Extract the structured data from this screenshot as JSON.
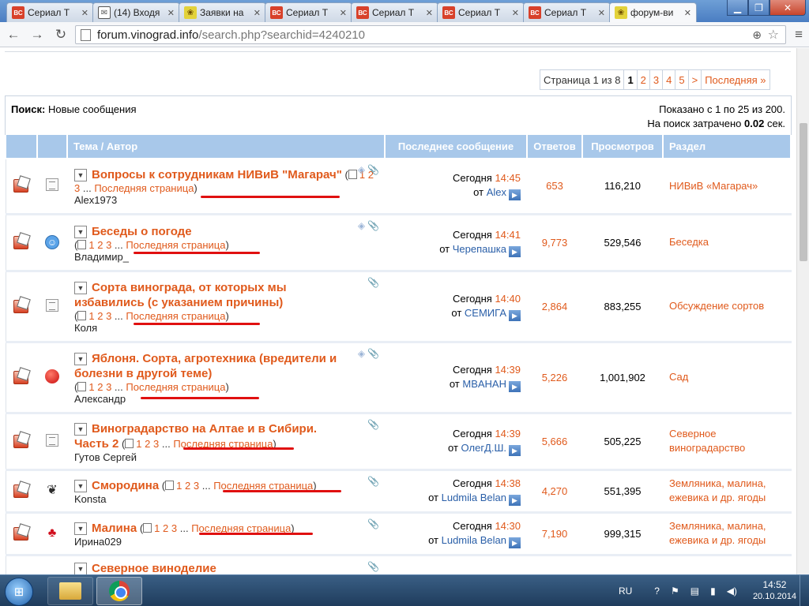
{
  "browser": {
    "tabs": [
      {
        "label": "Сериал Т",
        "favicon": "vc-icon",
        "active": false
      },
      {
        "label": "(14) Входя",
        "favicon": "mail-icon",
        "active": false
      },
      {
        "label": "Заявки на",
        "favicon": "grape-icon",
        "active": false
      },
      {
        "label": "Сериал Т",
        "favicon": "vc-icon",
        "active": false
      },
      {
        "label": "Сериал Т",
        "favicon": "vc-icon",
        "active": false
      },
      {
        "label": "Сериал Т",
        "favicon": "vc-icon",
        "active": false
      },
      {
        "label": "Сериал Т",
        "favicon": "vc-icon",
        "active": false
      },
      {
        "label": "форум-ви",
        "favicon": "grape-icon",
        "active": true
      }
    ],
    "url_host": "forum.vinograd.info",
    "url_path": "/search.php?searchid=4240210",
    "favicon_text": {
      "vc": "ВС"
    }
  },
  "pagination": {
    "info": "Страница 1 из 8",
    "pages": [
      "1",
      "2",
      "3",
      "4",
      "5"
    ],
    "current": "1",
    "next": ">",
    "last": "Последняя »"
  },
  "search": {
    "label": "Поиск:",
    "query": "Новые сообщения",
    "shown": "Показано с 1 по 25 из 200.",
    "time_prefix": "На поиск затрачено",
    "time_value": "0.02",
    "time_suffix": "сек."
  },
  "table": {
    "headers": {
      "topic": "Тема / Автор",
      "last": "Последнее сообщение",
      "replies": "Ответов",
      "views": "Просмотров",
      "forum": "Раздел"
    },
    "page_links": [
      "1",
      "2",
      "3"
    ],
    "ellipsis": "...",
    "last_page": "Последняя страница",
    "today": "Сегодня",
    "from": "от",
    "rows": [
      {
        "title": "Вопросы к сотрудникам НИВиВ \"Магарач\"",
        "author": "Alex1973",
        "time": "14:45",
        "user": "Alex",
        "replies": "653",
        "views": "116,210",
        "forum": "НИВиВ «Магарач»",
        "status_icon": "document-icon",
        "tag": true
      },
      {
        "title": "Беседы о погоде",
        "author": "Владимир_",
        "time": "14:41",
        "user": "Черепашка",
        "replies": "9,773",
        "views": "529,546",
        "forum": "Беседка",
        "status_icon": "smile-icon",
        "tag": true
      },
      {
        "title": "Сорта винограда, от которых мы избавились (с указанием причины)",
        "author": "Коля",
        "time": "14:40",
        "user": "СЕМИГА",
        "replies": "2,864",
        "views": "883,255",
        "forum": "Обсуждение сортов",
        "status_icon": "document-icon",
        "tag": false
      },
      {
        "title": "Яблоня. Сорта, агротехника (вредители и болезни в другой теме)",
        "author": "Александр",
        "time": "14:39",
        "user": "MBAHAH",
        "replies": "5,226",
        "views": "1,001,902",
        "forum": "Сад",
        "status_icon": "apple-icon",
        "tag": true
      },
      {
        "title": "Виноградарство на Алтае и в Сибири. Часть 2",
        "author": "Гутов Сергей",
        "time": "14:39",
        "user": "ОлегД.Ш.",
        "replies": "5,666",
        "views": "505,225",
        "forum": "Северное виноградарство",
        "status_icon": "document-icon",
        "tag": false
      },
      {
        "title": "Смородина",
        "author": "Konsta",
        "time": "14:38",
        "user": "Ludmila Belan",
        "replies": "4,270",
        "views": "551,395",
        "forum": "Земляника, малина, ежевика и др. ягоды",
        "status_icon": "currant-icon",
        "tag": false
      },
      {
        "title": "Малина",
        "author": "Ирина029",
        "time": "14:30",
        "user": "Ludmila Belan",
        "replies": "7,190",
        "views": "999,315",
        "forum": "Земляника, малина, ежевика и др. ягоды",
        "status_icon": "cherry-icon",
        "tag": false
      },
      {
        "title": "Северное виноделие",
        "author": "",
        "time": "",
        "user": "",
        "replies": "",
        "views": "",
        "forum": "",
        "status_icon": "document-icon",
        "tag": false
      }
    ]
  },
  "taskbar": {
    "lang": "RU",
    "time": "14:52",
    "date": "20.10.2014"
  },
  "colors": {
    "accent": "#e05a1c",
    "header_bg": "#a8c8ea",
    "link_blue": "#2a5fa8",
    "underline": "#e01010"
  }
}
